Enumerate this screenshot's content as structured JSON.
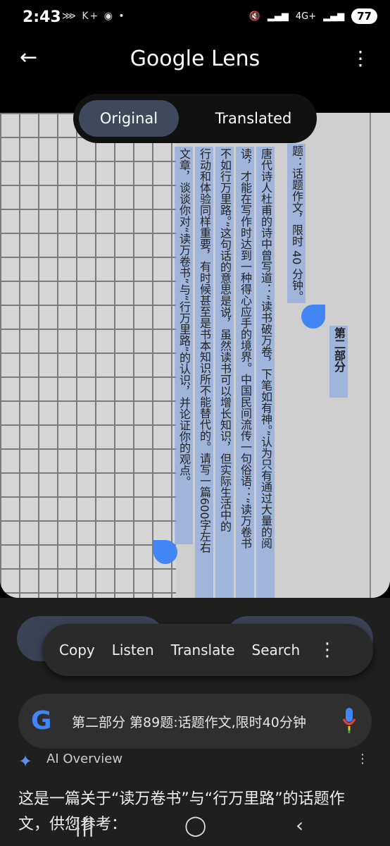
{
  "status": {
    "time": "2:43",
    "battery": "77",
    "network": "4G+",
    "left_icons": "⋙ K+ ◉ •"
  },
  "app": {
    "title": "Google Lens"
  },
  "toggle": {
    "original": "Original",
    "translated": "Translated"
  },
  "photo": {
    "columns": [
      "唐代诗人杜甫的诗中曾写道：“读书破万卷，下笔如有神。”认为只有通过大量的阅",
      "读，才能在写作时达到一种得心应手的境界。中国民间流传一句俗语：“读万卷书",
      "不如行万里路。”这句话的意思是说，虽然读书可以增长知识，但实际生活中的",
      "行动和体验同样重要，有时候甚至是书本知识所不能替代的。请写一篇600字左右",
      "文章，谈谈你对“读万卷书”与“行万里路”的认识，并论证你的观点。"
    ],
    "topic_line": "题：话题作文，限时 40 分钟。",
    "section": "第二部分"
  },
  "actions": {
    "copy": "Copy",
    "listen": "Listen",
    "translate": "Translate",
    "search": "Search"
  },
  "search": {
    "query": "第二部分 第89题:话题作文,限时40分钟"
  },
  "ai": {
    "title": "AI Overview",
    "answer": "这是一篇关于“读万卷书”与“行万里路”的话题作文，供您参考："
  },
  "nav": {
    "recent": "|||",
    "home": "◯",
    "back": "‹"
  }
}
